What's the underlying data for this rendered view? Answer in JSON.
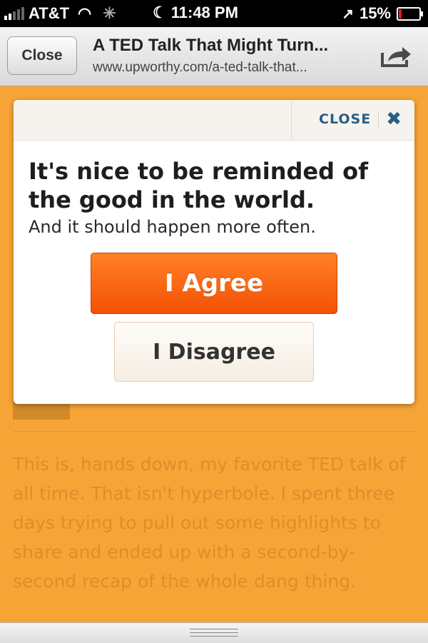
{
  "status_bar": {
    "carrier": "AT&T",
    "time": "11:48 PM",
    "battery": "15%",
    "battery_level": 0.15,
    "signal_bars": 5,
    "signal_active": 2
  },
  "browser": {
    "close_label": "Close",
    "title": "A TED Talk That Might Turn...",
    "url": "www.upworthy.com/a-ted-talk-that...",
    "share_icon": "share-icon"
  },
  "modal": {
    "close_label": "CLOSE",
    "close_icon": "close-icon",
    "headline": "It's nice to be reminded of the good in the world.",
    "subline": "And it should happen more often.",
    "agree_label": "I Agree",
    "disagree_label": "I Disagree"
  },
  "article": {
    "paragraph": "This is, hands down, my favorite TED talk of all time. That isn't hyperbole. I spent three days trying to pull out some highlights to share and ended up with a second-by-second recap of the whole dang thing."
  },
  "colors": {
    "overlay": "#f7a437",
    "agree": "#f45105",
    "link": "#2a5d86"
  }
}
